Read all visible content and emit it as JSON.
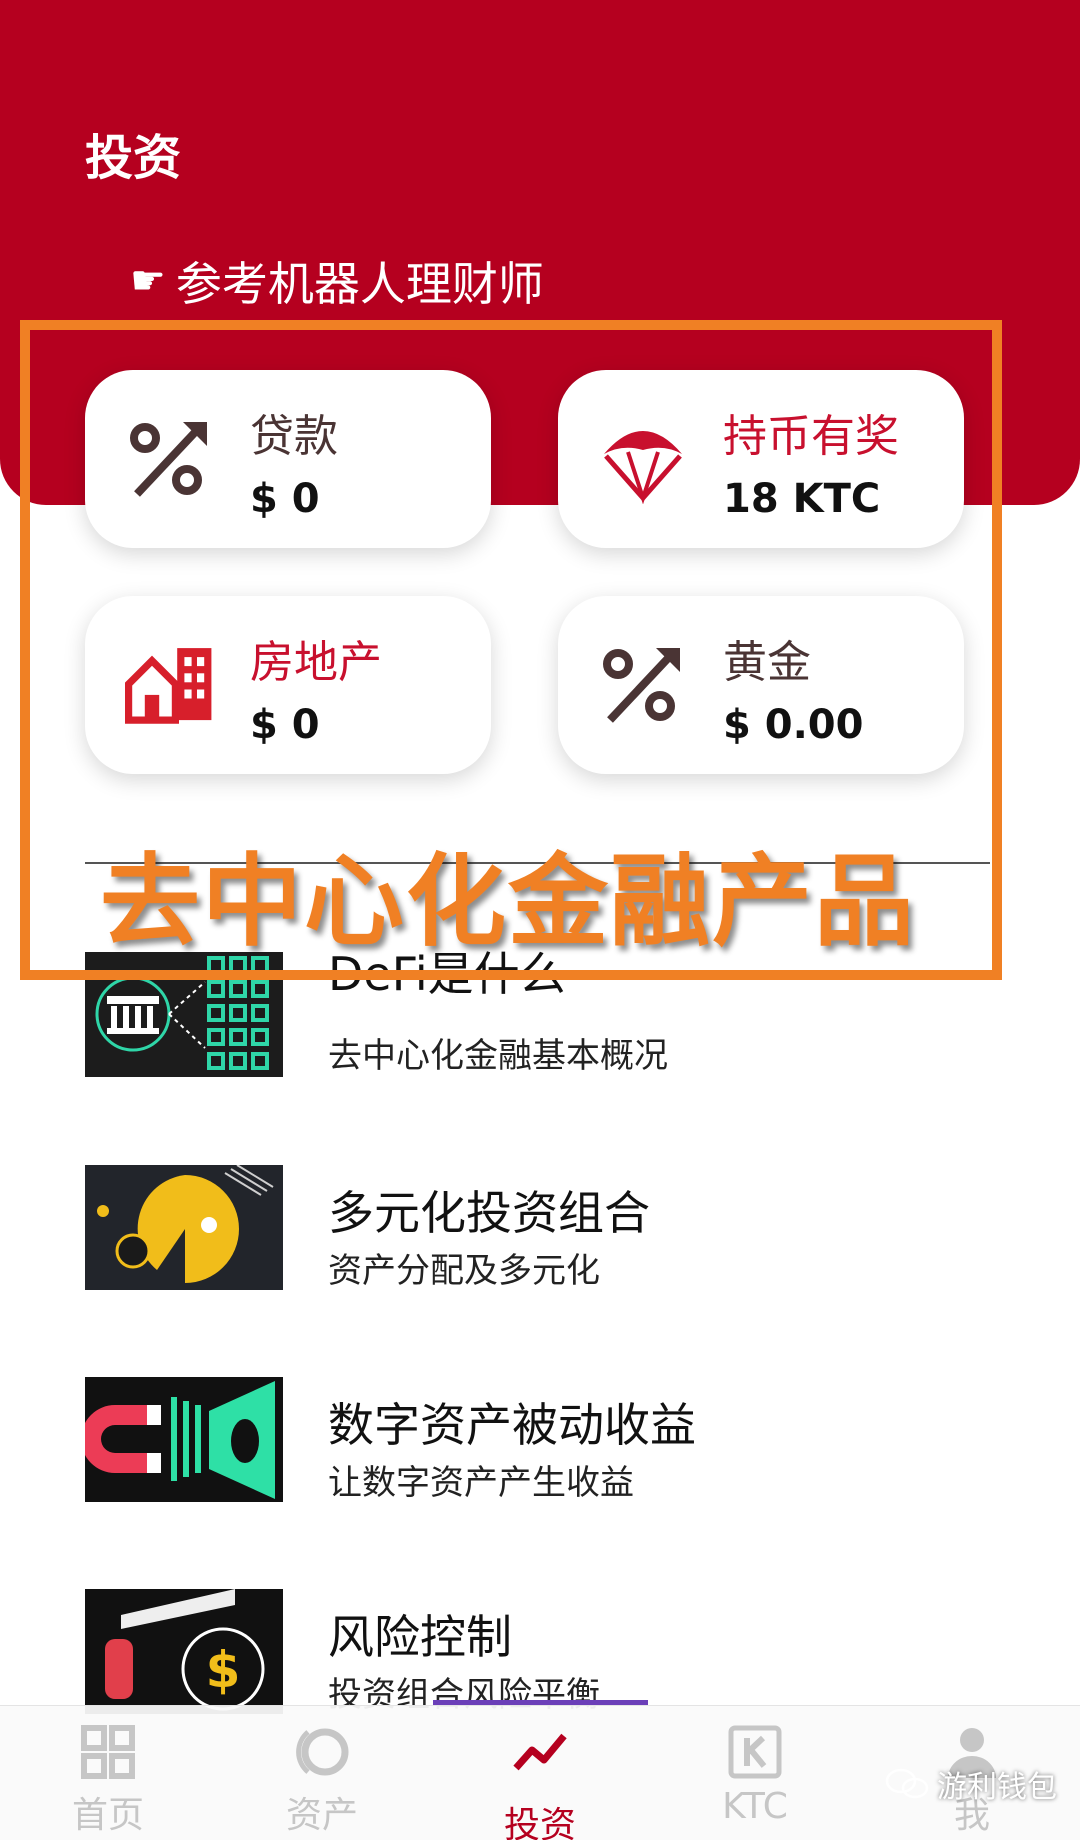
{
  "header": {
    "title": "投资",
    "robot_link": "参考机器人理财师"
  },
  "cards": {
    "loan": {
      "label": "贷款",
      "value": "$ 0",
      "icon": "percent-arrow-icon"
    },
    "hold": {
      "label": "持币有奖",
      "value": "18 KTC",
      "icon": "parachute-icon"
    },
    "realestate": {
      "label": "房地产",
      "value": "$ 0",
      "icon": "building-icon"
    },
    "gold": {
      "label": "黄金",
      "value": "$ 0.00",
      "icon": "percent-arrow-icon"
    }
  },
  "annotation": {
    "text": "去中心化金融产品"
  },
  "articles": [
    {
      "title": "DeFi是什么",
      "subtitle": "去中心化金融基本概况",
      "icon": "bank-network-icon"
    },
    {
      "title": "多元化投资组合",
      "subtitle": "资产分配及多元化",
      "icon": "pie-diversify-icon"
    },
    {
      "title": "数字资产被动收益",
      "subtitle": "让数字资产产生收益",
      "icon": "magnet-icon"
    },
    {
      "title": "风险控制",
      "subtitle": "投资组合风险平衡",
      "icon": "money-bag-icon"
    }
  ],
  "tabbar": {
    "items": [
      {
        "label": "首页",
        "icon": "grid-icon"
      },
      {
        "label": "资产",
        "icon": "ring-icon"
      },
      {
        "label": "投资",
        "icon": "trend-line-icon"
      },
      {
        "label": "KTC",
        "icon": "k-box-icon"
      },
      {
        "label": "我",
        "icon": "user-icon"
      }
    ],
    "active": "投资"
  },
  "watermark": {
    "text": "游利钱包",
    "icon": "wechat-icon"
  },
  "colors": {
    "brand_red": "#b5001f",
    "annotation_orange": "#f08024",
    "tab_inactive": "#c6c6c6",
    "underline_purple": "#6b3fb8"
  }
}
